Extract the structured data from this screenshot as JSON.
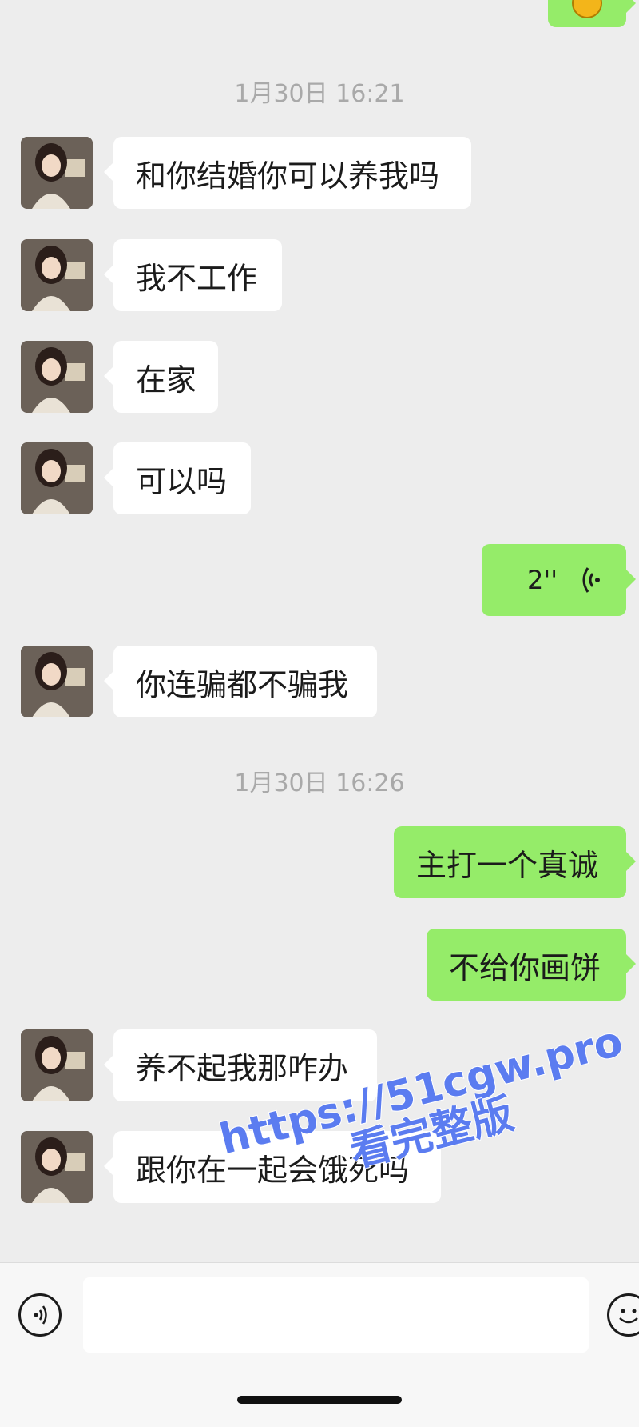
{
  "messages": [
    {
      "type": "time",
      "text": "1月30日 16:21"
    },
    {
      "type": "in",
      "text": "和你结婚你可以养我吗"
    },
    {
      "type": "in",
      "text": "我不工作"
    },
    {
      "type": "in",
      "text": "在家"
    },
    {
      "type": "in",
      "text": "可以吗"
    },
    {
      "type": "voice-out",
      "text": "2''"
    },
    {
      "type": "in",
      "text": "你连骗都不骗我"
    },
    {
      "type": "time",
      "text": "1月30日 16:26"
    },
    {
      "type": "out",
      "text": "主打一个真诚"
    },
    {
      "type": "out",
      "text": "不给你画饼"
    },
    {
      "type": "in",
      "text": "养不起我那咋办"
    },
    {
      "type": "in",
      "text": "跟你在一起会饿死吗"
    }
  ],
  "input": {
    "value": "",
    "placeholder": ""
  },
  "watermark": {
    "line1": "https://51cgw.pro",
    "line2": "看完整版"
  },
  "colors": {
    "background": "#ededed",
    "incoming_bubble": "#ffffff",
    "outgoing_bubble": "#95ec69",
    "timestamp": "#a9a9a9",
    "watermark": "#5b7cf0"
  }
}
